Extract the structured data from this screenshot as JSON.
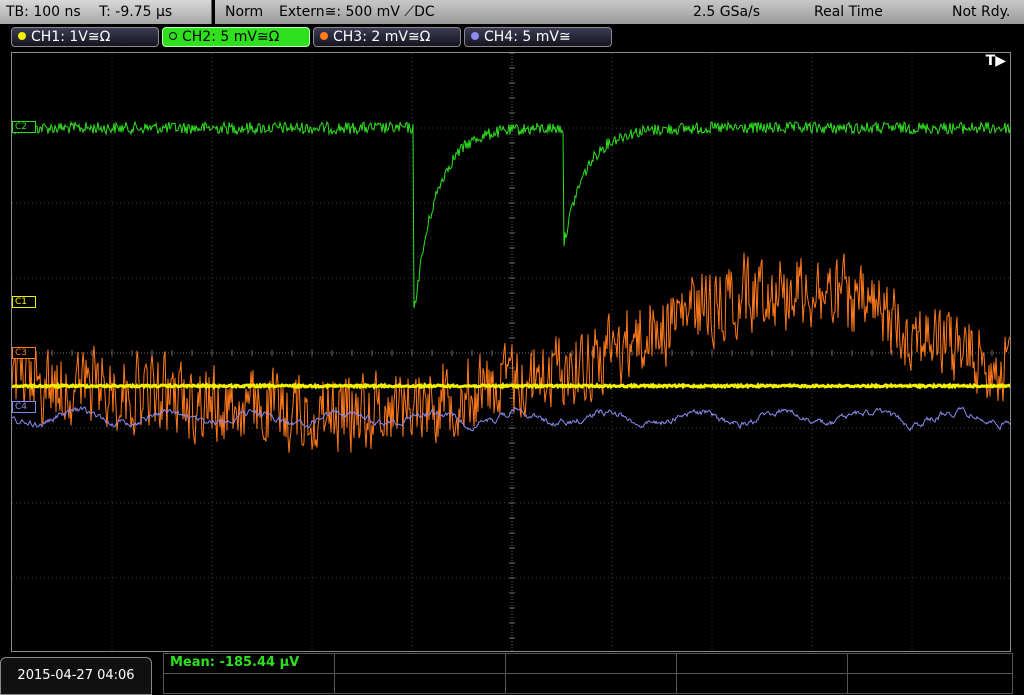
{
  "status": {
    "timebase": "TB: 100 ns",
    "trigger_offset": "T: -9.75 µs",
    "mode": "Norm",
    "trigger_source": "Extern≅: 500 mV ⟋DC",
    "sample_rate": "2.5 GSa/s",
    "acq_type": "Real Time",
    "state": "Not Rdy."
  },
  "channels": [
    {
      "label": "CH1: 1V≅Ω",
      "color": "#f2f200",
      "marker": "C1"
    },
    {
      "label": "CH2: 5 mV≅Ω",
      "color": "#2fe01f",
      "marker": "C2"
    },
    {
      "label": "CH3: 2 mV≅Ω",
      "color": "#ff7a1a",
      "marker": "C3"
    },
    {
      "label": "CH4: 5 mV≅",
      "color": "#8a8af0",
      "marker": "C4"
    }
  ],
  "trigger_indicator": "T▶",
  "date": "2015-04-27 04:06",
  "measurement": {
    "mean": "Mean: -185.44 µV"
  }
}
